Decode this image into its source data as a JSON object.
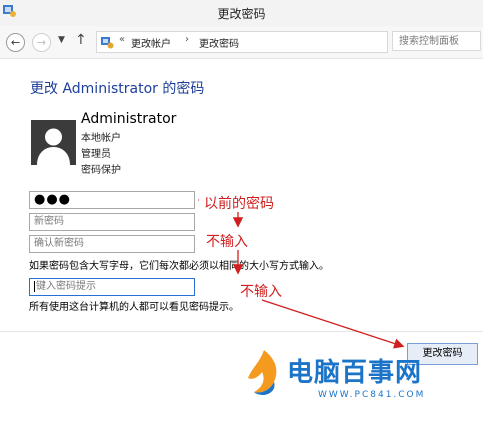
{
  "window": {
    "title": "更改密码"
  },
  "nav": {
    "back_icon": "arrow-left-icon",
    "forward_icon": "arrow-right-icon",
    "up_icon": "arrow-up-icon",
    "refresh_icon": "refresh-icon"
  },
  "breadcrumb": {
    "prefix": "«",
    "items": [
      "更改帐户",
      "更改密码"
    ],
    "separator": "›"
  },
  "search": {
    "placeholder": "搜索控制面板"
  },
  "page": {
    "heading": "更改 Administrator 的密码"
  },
  "user": {
    "name": "Administrator",
    "info": [
      "本地帐户",
      "管理员",
      "密码保护"
    ]
  },
  "form": {
    "current_password_value": "●●●",
    "new_password_placeholder": "新密码",
    "confirm_password_placeholder": "确认新密码",
    "caps_note": "如果密码包含大写字母，它们每次都必须以相同的大小写方式输入。",
    "hint_placeholder": "键入密码提示",
    "hint_note": "所有使用这台计算机的人都可以看见密码提示。",
    "submit_label": "更改密码"
  },
  "annotations": {
    "previous_password": "以前的密码",
    "no_input_1": "不输入",
    "no_input_2": "不输入",
    "color": "#d11f1f"
  },
  "watermark": {
    "text": "电脑百事网",
    "url": "WWW.PC841.COM",
    "color": "#1c74c9"
  }
}
